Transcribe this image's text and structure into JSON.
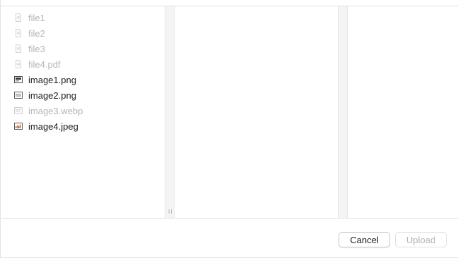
{
  "browser": {
    "files": [
      {
        "name": "file1",
        "icon": "text-file-icon",
        "enabled": false
      },
      {
        "name": "file2",
        "icon": "text-file-icon",
        "enabled": false
      },
      {
        "name": "file3",
        "icon": "text-file-icon",
        "enabled": false
      },
      {
        "name": "file4.pdf",
        "icon": "pdf-file-icon",
        "enabled": false
      },
      {
        "name": "image1.png",
        "icon": "image-file-icon",
        "enabled": true
      },
      {
        "name": "image2.png",
        "icon": "image-file-icon",
        "enabled": true
      },
      {
        "name": "image3.webp",
        "icon": "image-file-icon",
        "enabled": false
      },
      {
        "name": "image4.jpeg",
        "icon": "photo-file-icon",
        "enabled": true
      }
    ],
    "resize_grip": "ll"
  },
  "footer": {
    "cancel_label": "Cancel",
    "upload_label": "Upload",
    "upload_enabled": false
  },
  "colors": {
    "enabled_text": "#1e1e1e",
    "disabled_text": "#b5b5b5",
    "divider_fill": "#f4f4f4"
  }
}
